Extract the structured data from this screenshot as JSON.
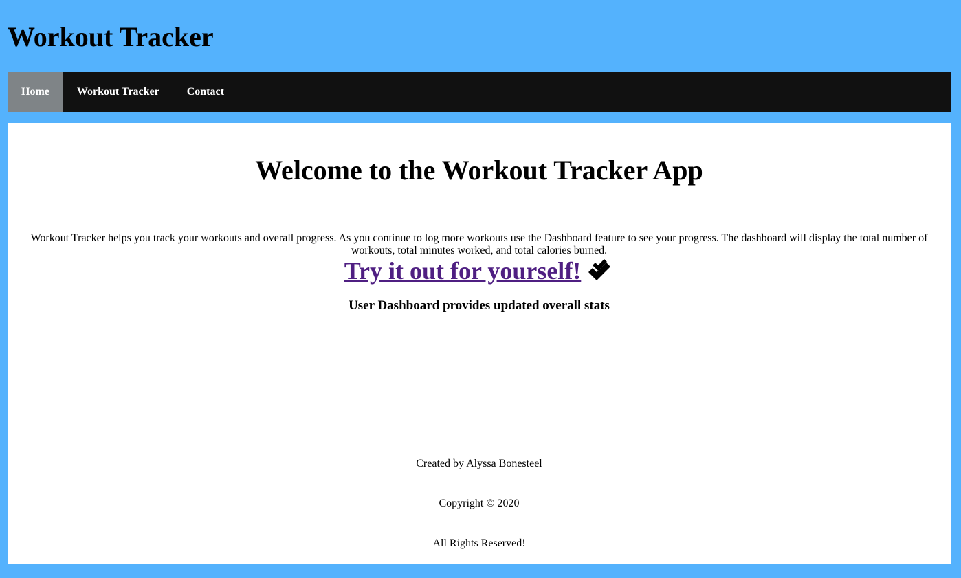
{
  "header": {
    "title": "Workout Tracker"
  },
  "nav": {
    "items": [
      {
        "label": "Home",
        "active": true
      },
      {
        "label": "Workout Tracker",
        "active": false
      },
      {
        "label": "Contact",
        "active": false
      }
    ]
  },
  "main": {
    "heading": "Welcome to the Workout Tracker App",
    "intro": "Workout Tracker helps you track your workouts and overall progress. As you continue to log more workouts use the Dashboard feature to see your progress. The dashboard will display the total number of workouts, total minutes worked, and total calories burned.",
    "cta_label": "Try it out for yourself!",
    "cta_icon": "double-check-icon",
    "dashboard_text": "User Dashboard provides updated overall stats"
  },
  "footer": {
    "created_by": "Created by Alyssa Bonesteel",
    "copyright": "Copyright © 2020",
    "rights": "All Rights Reserved!"
  },
  "colors": {
    "page_background": "#54b2fd",
    "navbar_background": "#111111",
    "nav_active_background": "#7f8487",
    "content_background": "#ffffff",
    "link_visited": "#4f1f82"
  }
}
